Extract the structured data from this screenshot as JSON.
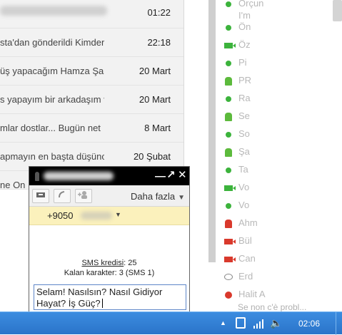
{
  "emails": [
    {
      "subject": "",
      "date": "01:22"
    },
    {
      "subject": "sta'dan gönderildi Kimder",
      "date": "22:18"
    },
    {
      "subject": "üş yapacağım Hamza Şa",
      "date": "20 Mart"
    },
    {
      "subject": "s yapayım bir arkadaşım v",
      "date": "20 Mart"
    },
    {
      "subject": "mlar dostlar... Bugün net",
      "date": "8 Mart"
    },
    {
      "subject": "apmayın en başta düşünc",
      "date": "20 Şubat"
    },
    {
      "subject": "ne On",
      "date": ""
    }
  ],
  "sidebar": {
    "contacts": [
      {
        "name": "Orçun",
        "status": "green-dot"
      },
      {
        "name": "I'm",
        "status": "none"
      },
      {
        "name": "Ön",
        "status": "green-dot"
      },
      {
        "name": "Öz",
        "status": "video-green"
      },
      {
        "name": "Pi",
        "status": "green-dot"
      },
      {
        "name": "PR",
        "status": "android-green"
      },
      {
        "name": "Ra",
        "status": "green-dot"
      },
      {
        "name": "Se",
        "status": "android-green"
      },
      {
        "name": "So",
        "status": "green-dot"
      },
      {
        "name": "Şa",
        "status": "android-green"
      },
      {
        "name": "Ta",
        "status": "green-dot"
      },
      {
        "name": "Vo",
        "status": "video-green"
      },
      {
        "name": "Vo",
        "status": "green-dot"
      },
      {
        "name": "Ahm",
        "status": "android-red"
      },
      {
        "name": "Bül",
        "status": "video-red"
      },
      {
        "name": "Can",
        "status": "video-red"
      },
      {
        "name": "Erd",
        "status": "speech-bubble"
      },
      {
        "name": "Halit A",
        "status": "busy-red"
      }
    ],
    "last_contact_status": "Se non c'è probl..."
  },
  "chat": {
    "contact_name": "",
    "minimize_glyph": "—",
    "popout_glyph": "↗",
    "close_glyph": "✕",
    "more_label": "Daha fazla",
    "phone_number": "+9050",
    "sms_credits_label": "SMS kredisi",
    "sms_credits_value": ": 25",
    "remaining_chars": "Kalan karakter: 3 (SMS 1)",
    "input_text": "Selam! Nasılsın? Nasıl Gidiyor Hayat? İş Güç?"
  },
  "taskbar": {
    "clock": "02:06"
  },
  "icons": [
    "video-chat-icon",
    "phone-icon",
    "add-user-icon",
    "lock-icon",
    "show-hidden-icons",
    "action-center-icon",
    "network-signal-icon",
    "volume-icon"
  ]
}
